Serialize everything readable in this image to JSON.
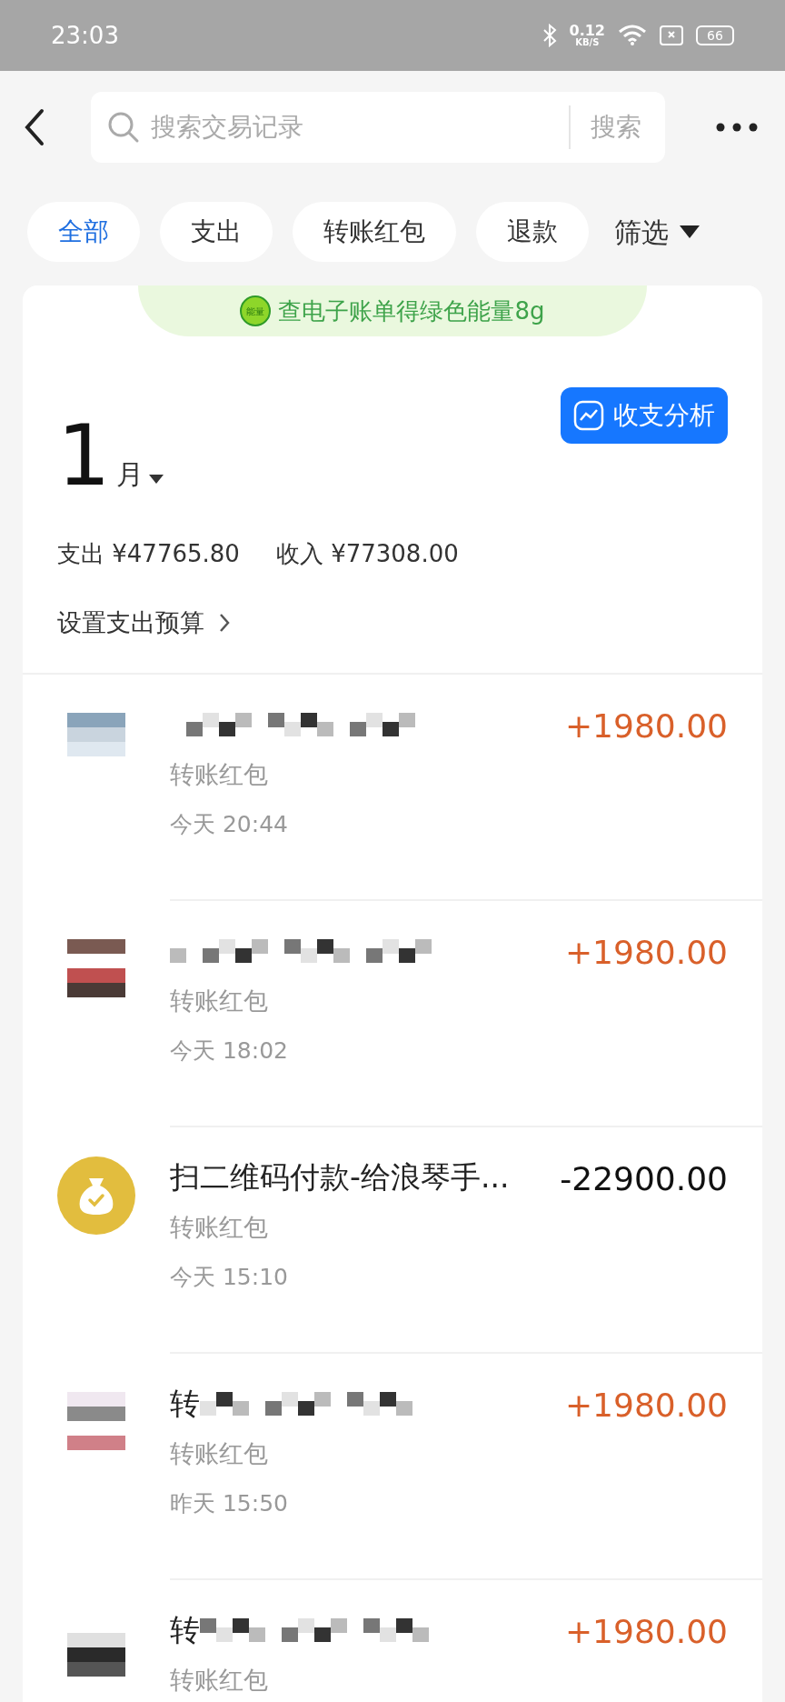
{
  "status_bar": {
    "time": "23:03",
    "speed": "0.12",
    "speed_unit": "KB/S",
    "battery": "66"
  },
  "header": {
    "search": {
      "placeholder": "搜索交易记录"
    },
    "search_button": "搜索"
  },
  "filters": [
    {
      "label": "全部",
      "selected": true
    },
    {
      "label": "支出",
      "selected": false
    },
    {
      "label": "转账红包",
      "selected": false
    },
    {
      "label": "退款",
      "selected": false
    }
  ],
  "filter_menu": "筛选",
  "banner": {
    "badge": "能量",
    "text": "查电子账单得绿色能量8g"
  },
  "month": {
    "number": "1",
    "unit": "月"
  },
  "analysis_button": "收支分析",
  "totals": [
    {
      "label": "支出",
      "value": "¥47765.80"
    },
    {
      "label": "收入",
      "value": "¥77308.00"
    }
  ],
  "budget_link": "设置支出预算",
  "transactions": [
    {
      "kind": "person",
      "category": "转账红包",
      "time": "今天 20:44",
      "amount": "+1980.00",
      "income": true
    },
    {
      "kind": "person",
      "category": "转账红包",
      "time": "今天 18:02",
      "amount": "+1980.00",
      "income": true
    },
    {
      "kind": "merchant",
      "name_visible": "扫二维码付款-给浪琴手...",
      "category": "转账红包",
      "time": "今天 15:10",
      "amount": "-22900.00",
      "income": false
    },
    {
      "kind": "person",
      "name_visible": "转",
      "category": "转账红包",
      "time": "昨天 15:50",
      "amount": "+1980.00",
      "income": true
    },
    {
      "kind": "person",
      "name_visible": "转",
      "category": "转账红包",
      "amount": "+1980.00",
      "income": true
    }
  ]
}
